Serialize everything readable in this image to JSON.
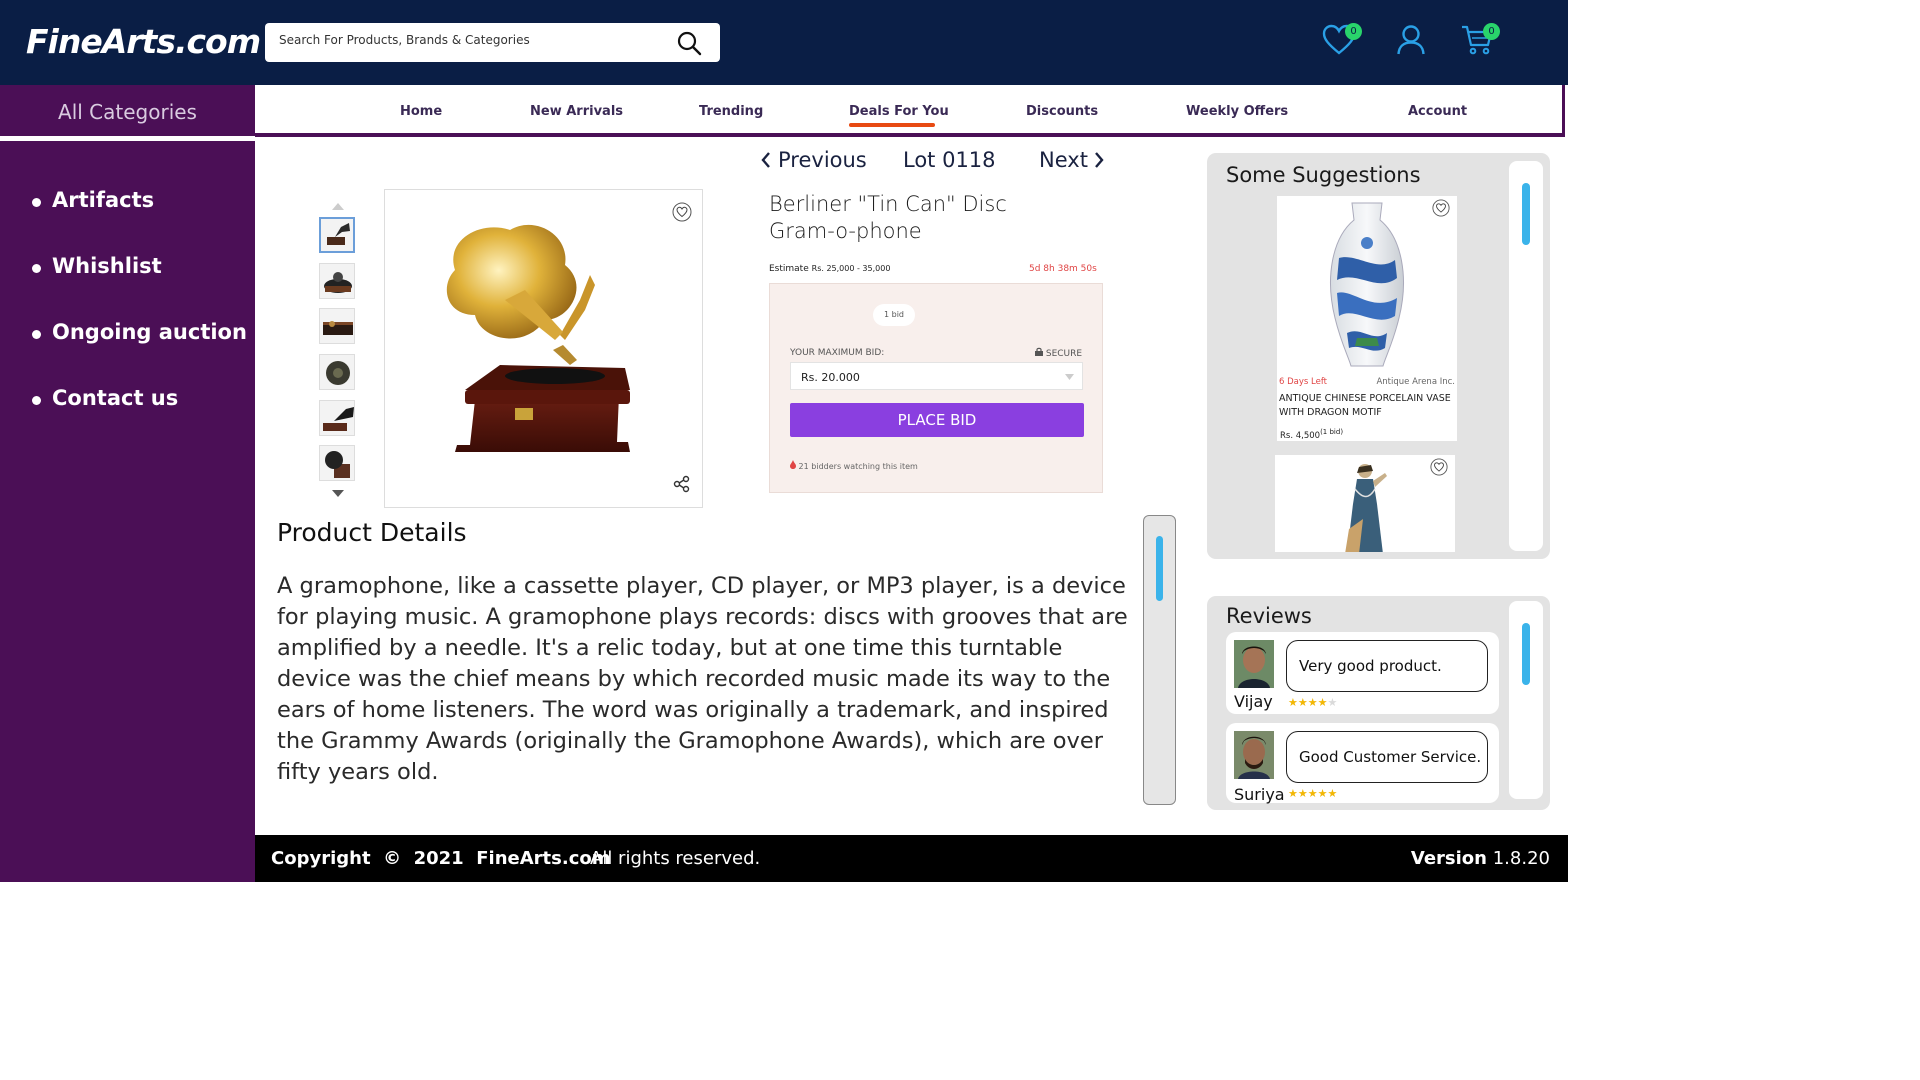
{
  "header": {
    "logo": "FineArts.com",
    "search_placeholder": "Search For Products, Brands & Categories",
    "wishlist_count": "0",
    "cart_count": "0"
  },
  "sidebar": {
    "all_categories": "All Categories",
    "items": [
      {
        "label": "Artifacts"
      },
      {
        "label": "Whishlist"
      },
      {
        "label": "Ongoing auction"
      },
      {
        "label": "Contact us"
      }
    ]
  },
  "nav": {
    "items": [
      "Home",
      "New Arrivals",
      "Trending",
      "Deals For You",
      "Discounts",
      "Weekly Offers",
      "Account"
    ],
    "active": "Deals For You"
  },
  "lot": {
    "previous": "Previous",
    "lot_label": "Lot 0118",
    "next": "Next"
  },
  "product": {
    "title": "Berliner \"Tin Can\" Disc Gram-o-phone",
    "estimate_label": "Estimate",
    "estimate_value": "Rs. 25,000 - 35,000",
    "timer": "5d 8h 38m 50s",
    "bids": "1 bid",
    "max_bid_label": "YOUR MAXIMUM BID:",
    "secure_label": "SECURE",
    "bid_value": "Rs. 20.000",
    "place_bid": "PLACE BID",
    "watching": "21 bidders watching this item"
  },
  "details": {
    "title": "Product Details",
    "text": "A gramophone, like a cassette player, CD player, or MP3 player, is a device for playing music. A gramophone plays records: discs with grooves that are amplified by a needle. It's a relic today, but at one time this turntable device was the chief means by which recorded music made its way to the ears of home listeners. The word was originally a trademark, and inspired the Grammy Awards (originally the Gramophone Awards), which are over fifty years old."
  },
  "suggestions": {
    "title": "Some Suggestions",
    "items": [
      {
        "days_left": "6 Days Left",
        "seller": "Antique Arena Inc.",
        "name": "ANTIQUE CHINESE PORCELAIN VASE WITH DRAGON MOTIF",
        "price": "Rs. 4,500",
        "bids": "(1 bid)"
      }
    ]
  },
  "reviews": {
    "title": "Reviews",
    "items": [
      {
        "name": "Vijay",
        "text": "Very good product.",
        "rating": 4
      },
      {
        "name": "Suriya",
        "text": "Good Customer Service.",
        "rating": 5
      }
    ]
  },
  "footer": {
    "copyright": "Copyright  ©  2021  FineArts.com",
    "rights": "All rights reserved.",
    "version_label": "Version",
    "version_number": "1.8.20"
  },
  "colors": {
    "header_bg": "#0a1e45",
    "sidebar_bg": "#4b0f56",
    "accent_purple": "#8a3fe0",
    "nav_active_underline": "#e84a12",
    "scroll_thumb": "#3ab3ea",
    "badge_green": "#29d46b"
  }
}
